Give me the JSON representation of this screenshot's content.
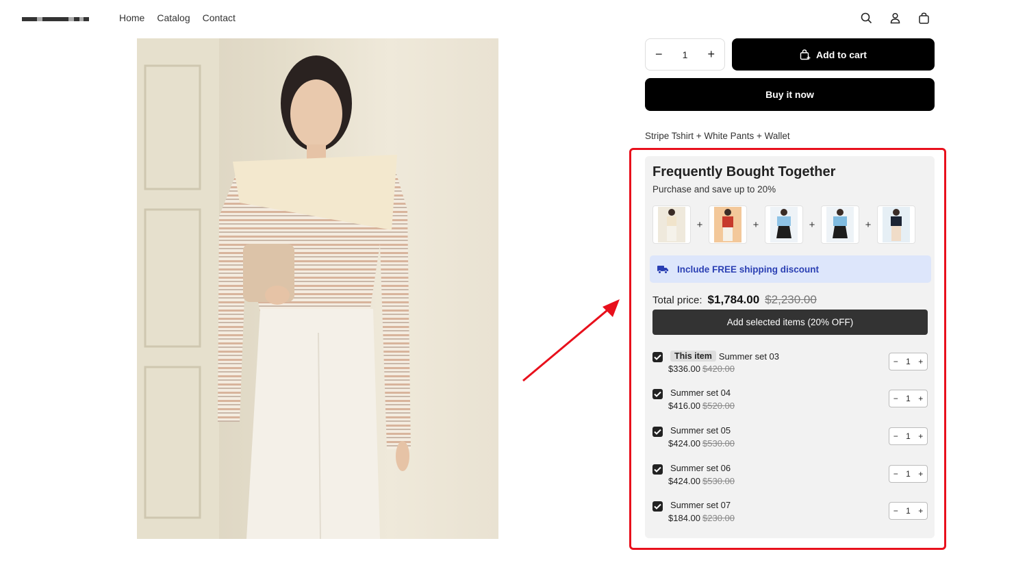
{
  "header": {
    "nav": [
      "Home",
      "Catalog",
      "Contact"
    ],
    "icons": [
      "search-icon",
      "account-icon",
      "cart-icon"
    ]
  },
  "product": {
    "quantity": "1",
    "add_to_cart": "Add to cart",
    "buy_now": "Buy it now",
    "bundle_text": "Stripe Tshirt + White Pants + Wallet"
  },
  "fbt": {
    "title": "Frequently Bought Together",
    "subtitle": "Purchase and save up to 20%",
    "plus": "+",
    "shipping": "Include FREE shipping discount",
    "total_label": "Total price:",
    "total_now": "$1,784.00",
    "total_was": "$2,230.00",
    "add_selected": "Add selected items (20% OFF)",
    "items": [
      {
        "badge": "This item",
        "name": "Summer set 03",
        "price": "$336.00",
        "was": "$420.00",
        "qty": "1",
        "checked": true
      },
      {
        "name": "Summer set 04",
        "price": "$416.00",
        "was": "$520.00",
        "qty": "1",
        "checked": true
      },
      {
        "name": "Summer set 05",
        "price": "$424.00",
        "was": "$530.00",
        "qty": "1",
        "checked": true
      },
      {
        "name": "Summer set 06",
        "price": "$424.00",
        "was": "$530.00",
        "qty": "1",
        "checked": true
      },
      {
        "name": "Summer set 07",
        "price": "$184.00",
        "was": "$230.00",
        "qty": "1",
        "checked": true
      }
    ]
  },
  "colors": {
    "highlight": "#e8101c",
    "banner_bg": "#dde6fb",
    "banner_text": "#2a3fb3"
  }
}
